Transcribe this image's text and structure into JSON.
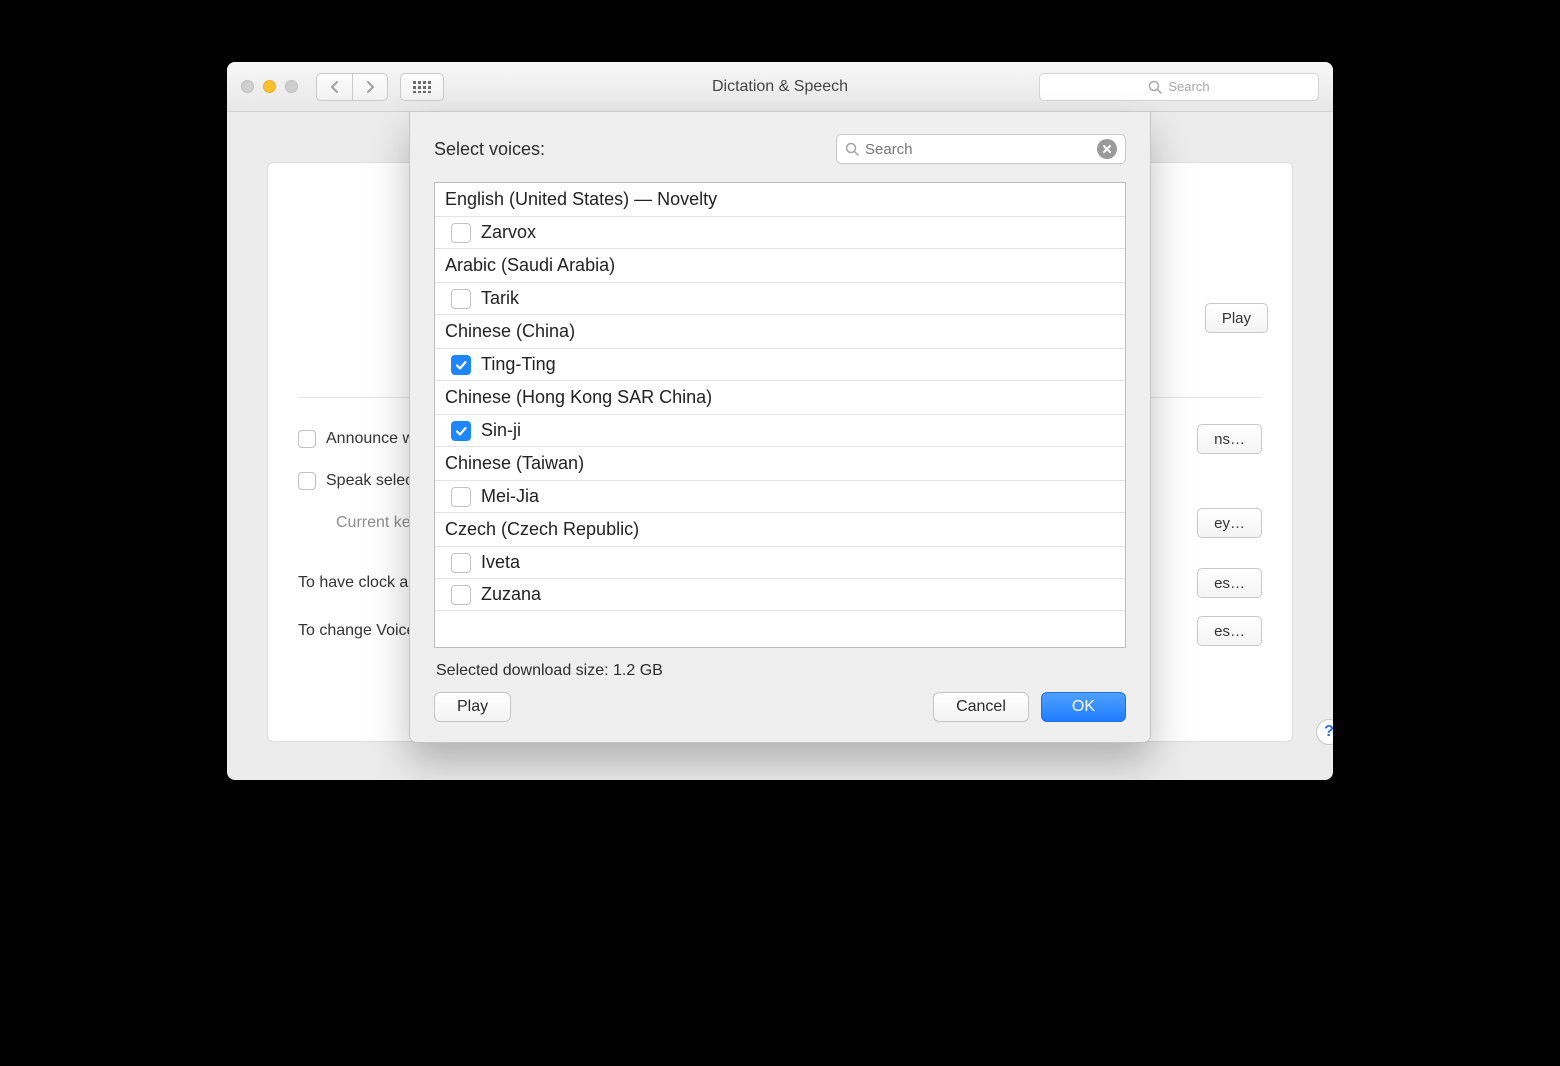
{
  "window": {
    "title": "Dictation & Speech",
    "search_placeholder": "Search"
  },
  "background": {
    "announce_label": "Announce when alerts are displayed",
    "speak_label": "Speak selected text when the key is pressed",
    "current_key_label": "Current key:",
    "to_have_text": "To have clock announce the time:",
    "to_change_text": "To change VoiceOver settings:",
    "play_button": "Play",
    "options_button": "ns…",
    "key_button": "ey…",
    "es_button1": "es…",
    "es_button2": "es…"
  },
  "sheet": {
    "label": "Select voices:",
    "search_placeholder": "Search",
    "groups": [
      {
        "header": "English (United States) — Novelty",
        "items": [
          {
            "name": "Zarvox",
            "checked": false
          }
        ]
      },
      {
        "header": "Arabic (Saudi Arabia)",
        "items": [
          {
            "name": "Tarik",
            "checked": false
          }
        ]
      },
      {
        "header": "Chinese (China)",
        "items": [
          {
            "name": "Ting-Ting",
            "checked": true
          }
        ]
      },
      {
        "header": "Chinese (Hong Kong SAR China)",
        "items": [
          {
            "name": "Sin-ji",
            "checked": true
          }
        ]
      },
      {
        "header": "Chinese (Taiwan)",
        "items": [
          {
            "name": "Mei-Jia",
            "checked": false
          }
        ]
      },
      {
        "header": "Czech (Czech Republic)",
        "items": [
          {
            "name": "Iveta",
            "checked": false
          },
          {
            "name": "Zuzana",
            "checked": false
          }
        ]
      }
    ],
    "download_size_label": "Selected download size: 1.2 GB",
    "play_button": "Play",
    "cancel_button": "Cancel",
    "ok_button": "OK"
  }
}
